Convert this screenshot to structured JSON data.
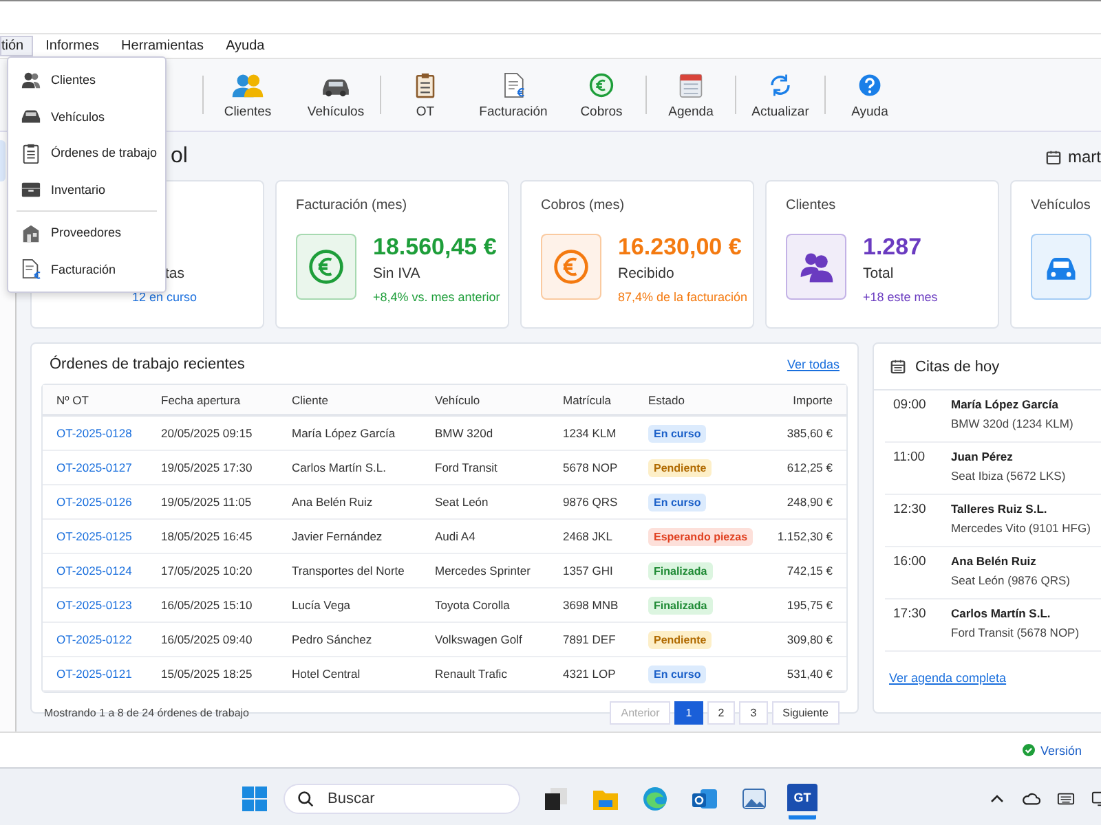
{
  "menu_bar": [
    {
      "label": "tión",
      "selected": true
    },
    {
      "label": "Informes",
      "selected": false
    },
    {
      "label": "Herramientas",
      "selected": false
    },
    {
      "label": "Ayuda",
      "selected": false
    }
  ],
  "dropdown": [
    {
      "label": "Clientes",
      "separator_before": false
    },
    {
      "label": "Vehículos",
      "separator_before": false
    },
    {
      "label": "Órdenes de trabajo",
      "separator_before": false
    },
    {
      "label": "Inventario",
      "separator_before": false
    },
    {
      "label": "Proveedores",
      "separator_before": true
    },
    {
      "label": "Facturación",
      "separator_before": false
    }
  ],
  "toolbar": [
    {
      "label": "Clientes",
      "separator_before": true
    },
    {
      "label": "Vehículos",
      "separator_before": false
    },
    {
      "label": "OT",
      "separator_before": true
    },
    {
      "label": "Facturación",
      "separator_before": false
    },
    {
      "label": "Cobros",
      "separator_before": false
    },
    {
      "label": "Agenda",
      "separator_before": true
    },
    {
      "label": "Actualizar",
      "separator_before": true
    },
    {
      "label": "Ayuda",
      "separator_before": true
    }
  ],
  "page_title": "ol",
  "date": "mart",
  "cards": [
    {
      "subtitle": "tas",
      "trend": "12 en curso",
      "color": "#1a6fdd"
    },
    {
      "label": "Facturación (mes)",
      "value": "18.560,45 €",
      "subtitle": "Sin IVA",
      "trend": "+8,4% vs. mes anterior",
      "color": "#1e9e3a"
    },
    {
      "label": "Cobros (mes)",
      "value": "16.230,00 €",
      "subtitle": "Recibido",
      "trend": "87,4%  de la facturación",
      "color": "#f47a10"
    },
    {
      "label": "Clientes",
      "value": "1.287",
      "subtitle": "Total",
      "trend": "+18 este mes",
      "color": "#6a3bc0"
    },
    {
      "label": "Vehículos",
      "color": "#1a7fe8"
    }
  ],
  "orders": {
    "title": "Órdenes de trabajo recientes",
    "link": "Ver todas",
    "columns": [
      "Nº OT",
      "Fecha apertura",
      "Cliente",
      "Vehículo",
      "Matrícula",
      "Estado",
      "Importe"
    ],
    "rows": [
      {
        "id": "OT-2025-0128",
        "date": "20/05/2025 09:15",
        "client": "María López García",
        "vehicle": "BMW 320d",
        "plate": "1234 KLM",
        "status": "En curso",
        "kind": "progress",
        "amount": "385,60 €"
      },
      {
        "id": "OT-2025-0127",
        "date": "19/05/2025 17:30",
        "client": "Carlos Martín S.L.",
        "vehicle": "Ford Transit",
        "plate": "5678 NOP",
        "status": "Pendiente",
        "kind": "pending",
        "amount": "612,25 €"
      },
      {
        "id": "OT-2025-0126",
        "date": "19/05/2025 11:05",
        "client": "Ana Belén Ruiz",
        "vehicle": "Seat León",
        "plate": "9876 QRS",
        "status": "En curso",
        "kind": "progress",
        "amount": "248,90 €"
      },
      {
        "id": "OT-2025-0125",
        "date": "18/05/2025 16:45",
        "client": "Javier Fernández",
        "vehicle": "Audi A4",
        "plate": "2468 JKL",
        "status": "Esperando piezas",
        "kind": "waiting",
        "amount": "1.152,30 €"
      },
      {
        "id": "OT-2025-0124",
        "date": "17/05/2025 10:20",
        "client": "Transportes del Norte",
        "vehicle": "Mercedes Sprinter",
        "plate": "1357 GHI",
        "status": "Finalizada",
        "kind": "done",
        "amount": "742,15 €"
      },
      {
        "id": "OT-2025-0123",
        "date": "16/05/2025 15:10",
        "client": "Lucía Vega",
        "vehicle": "Toyota Corolla",
        "plate": "3698 MNB",
        "status": "Finalizada",
        "kind": "done",
        "amount": "195,75 €"
      },
      {
        "id": "OT-2025-0122",
        "date": "16/05/2025 09:40",
        "client": "Pedro Sánchez",
        "vehicle": "Volkswagen Golf",
        "plate": "7891 DEF",
        "status": "Pendiente",
        "kind": "pending",
        "amount": "309,80 €"
      },
      {
        "id": "OT-2025-0121",
        "date": "15/05/2025 18:25",
        "client": "Hotel Central",
        "vehicle": "Renault Trafic",
        "plate": "4321 LOP",
        "status": "En curso",
        "kind": "progress",
        "amount": "531,40 €"
      }
    ],
    "footer": "Mostrando 1 a 8 de 24 órdenes de trabajo",
    "pages": [
      {
        "label": "Anterior",
        "selected": false,
        "disabled": true
      },
      {
        "label": "1",
        "selected": true,
        "disabled": false
      },
      {
        "label": "2",
        "selected": false,
        "disabled": false
      },
      {
        "label": "3",
        "selected": false,
        "disabled": false
      },
      {
        "label": "Siguiente",
        "selected": false,
        "disabled": false
      }
    ]
  },
  "appointments": {
    "title": "Citas de hoy",
    "items": [
      {
        "time": "09:00",
        "name": "María López García",
        "detail": "BMW 320d (1234 KLM)"
      },
      {
        "time": "11:00",
        "name": "Juan Pérez",
        "detail": "Seat Ibiza (5672 LKS)"
      },
      {
        "time": "12:30",
        "name": "Talleres Ruiz S.L.",
        "detail": "Mercedes Vito (9101 HFG)"
      },
      {
        "time": "16:00",
        "name": "Ana Belén Ruiz",
        "detail": "Seat León (9876 QRS)"
      },
      {
        "time": "17:30",
        "name": "Carlos Martín S.L.",
        "detail": "Ford Transit (5678 NOP)"
      }
    ],
    "link": "Ver agenda completa"
  },
  "status_bar": {
    "version": "Versión"
  },
  "taskbar": {
    "search_placeholder": "Buscar",
    "app_badge": "GT"
  }
}
